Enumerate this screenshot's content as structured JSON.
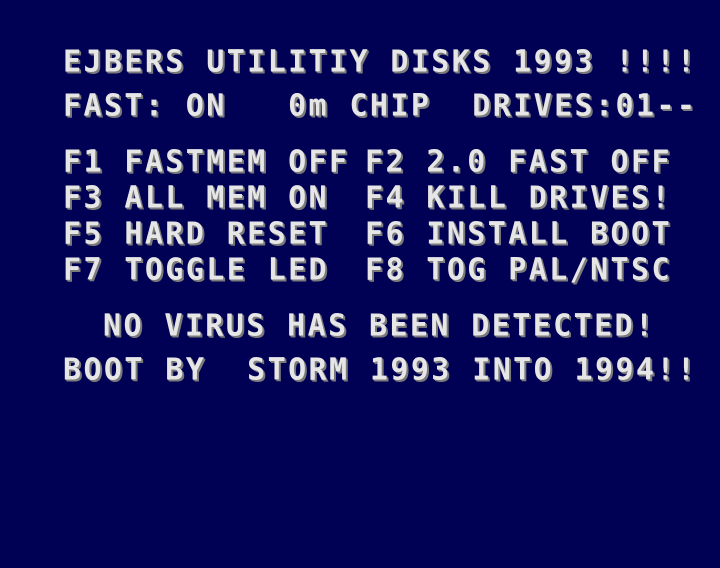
{
  "screen": {
    "title": "EJBERS UTILITIY DISKS 1993 !!!!",
    "status": "FAST: ON   0m CHIP  DRIVES:01--",
    "menu": [
      {
        "left": "F1 FASTMEM OFF",
        "right": "F2 2.0 FAST OFF"
      },
      {
        "left": "F3 ALL MEM ON",
        "right": "F4 KILL DRIVES!"
      },
      {
        "left": "F5 HARD RESET",
        "right": "F6 INSTALL BOOT"
      },
      {
        "left": "F7 TOGGLE LED",
        "right": "F8 TOG PAL/NTSC"
      }
    ],
    "virus_message": "NO VIRUS HAS BEEN DETECTED!",
    "credits": "BOOT BY  STORM 1993 INTO 1994!!"
  },
  "colors": {
    "background": "#000055",
    "text": "#e6e6e6",
    "text_shadow": "#7a7a7a"
  }
}
